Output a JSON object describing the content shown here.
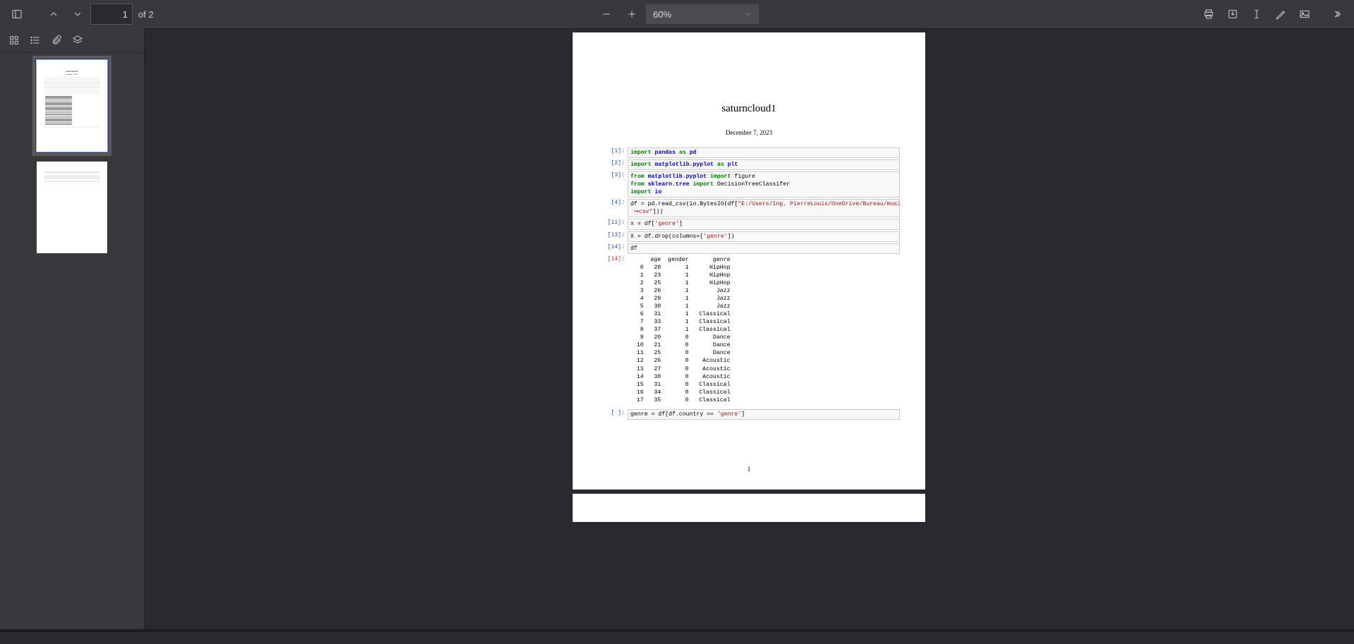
{
  "toolbar": {
    "page_current": "1",
    "page_total": "of 2",
    "zoom_label": "60%"
  },
  "doc": {
    "title": "saturncloud1",
    "date": "December 7, 2023",
    "page_number": "1"
  },
  "cells": [
    {
      "label": "[1]:",
      "html": "<span class='kw-import'>import</span> <span class='kw-name'>pandas</span> <span class='kw-as'>as</span> <span class='kw-name'>pd</span>"
    },
    {
      "label": "[2]:",
      "html": "<span class='kw-import'>import</span> <span class='kw-name'>matplotlib.pyplot</span> <span class='kw-as'>as</span> <span class='kw-name'>plt</span>"
    },
    {
      "label": "[3]:",
      "html": "<span class='kw-import'>from</span> <span class='kw-name'>matplotlib.pyplot</span> <span class='kw-import'>import</span> figure\n<span class='kw-import'>from</span> <span class='kw-name'>sklearn.tree</span> <span class='kw-import'>import</span> DecisionTreeClassifer\n<span class='kw-import'>import</span> <span class='kw-name'>io</span>"
    },
    {
      "label": "[4]:",
      "html": "df = pd.read_csv(io.BytesIO(df[<span class='kw-str'>\"E:/Users/Ing. PierreLouis/OneDrive/Bureau/music.</span>\n <span class='kw-str'>↪csv\"</span>]))"
    },
    {
      "label": "[11]:",
      "html": "x = df[<span class='kw-str'>'genre'</span>]"
    },
    {
      "label": "[13]:",
      "html": "X = df.drop(columns=[<span class='kw-str'>'genre'</span>])"
    },
    {
      "label": "[14]:",
      "html": "df"
    }
  ],
  "output_label": "[14]:",
  "table": {
    "header": [
      "",
      "age",
      "gender",
      "genre"
    ],
    "rows": [
      [
        "0",
        "20",
        "1",
        "HipHop"
      ],
      [
        "1",
        "23",
        "1",
        "HipHop"
      ],
      [
        "2",
        "25",
        "1",
        "HipHop"
      ],
      [
        "3",
        "26",
        "1",
        "Jazz"
      ],
      [
        "4",
        "29",
        "1",
        "Jazz"
      ],
      [
        "5",
        "30",
        "1",
        "Jazz"
      ],
      [
        "6",
        "31",
        "1",
        "Classical"
      ],
      [
        "7",
        "33",
        "1",
        "Classical"
      ],
      [
        "8",
        "37",
        "1",
        "Classical"
      ],
      [
        "9",
        "20",
        "0",
        "Dance"
      ],
      [
        "10",
        "21",
        "0",
        "Dance"
      ],
      [
        "11",
        "25",
        "0",
        "Dance"
      ],
      [
        "12",
        "26",
        "0",
        "Acoustic"
      ],
      [
        "13",
        "27",
        "0",
        "Acoustic"
      ],
      [
        "14",
        "30",
        "0",
        "Acoustic"
      ],
      [
        "15",
        "31",
        "0",
        "Classical"
      ],
      [
        "16",
        "34",
        "0",
        "Classical"
      ],
      [
        "17",
        "35",
        "0",
        "Classical"
      ]
    ]
  },
  "last_cell": {
    "label": "[ ]:",
    "html": "genre = df[df.country == <span class='kw-str'>'genre'</span>]"
  }
}
